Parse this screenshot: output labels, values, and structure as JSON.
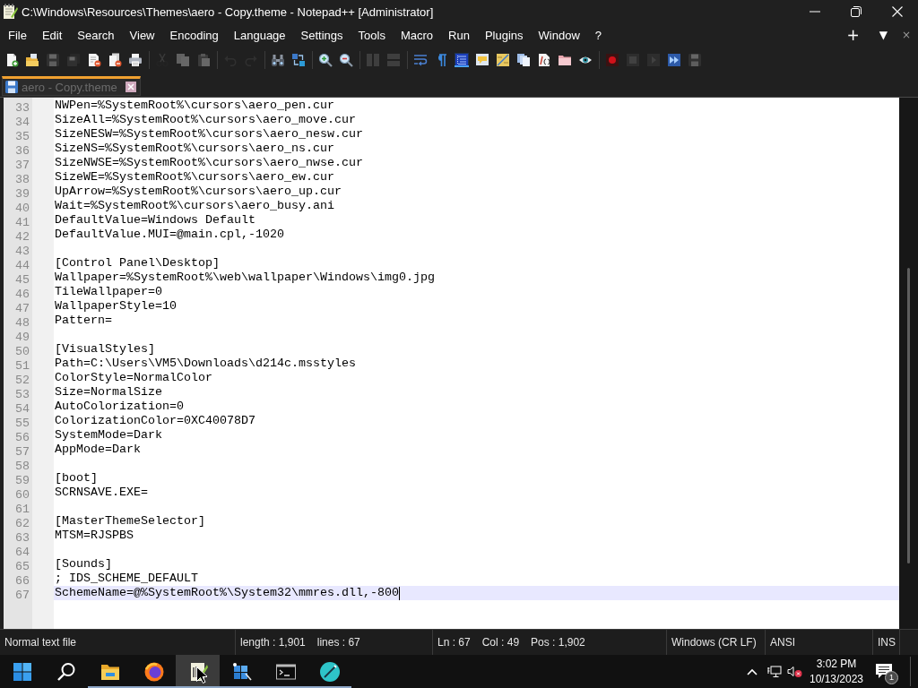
{
  "window": {
    "title": "C:\\Windows\\Resources\\Themes\\aero - Copy.theme - Notepad++ [Administrator]"
  },
  "menu_bar": {
    "items": [
      "File",
      "Edit",
      "Search",
      "View",
      "Encoding",
      "Language",
      "Settings",
      "Tools",
      "Macro",
      "Run",
      "Plugins",
      "Window",
      "?"
    ],
    "right_buttons": [
      {
        "kind": "add",
        "label": "+"
      },
      {
        "kind": "list",
        "label": "▼"
      },
      {
        "kind": "close",
        "label": "×"
      }
    ]
  },
  "toolbar": [
    [
      {
        "kind": "new",
        "disabled": false,
        "on": false
      },
      {
        "kind": "open",
        "disabled": false,
        "on": false
      },
      {
        "kind": "save",
        "disabled": true,
        "on": false
      },
      {
        "kind": "saveall",
        "disabled": true,
        "on": false
      },
      {
        "kind": "close",
        "disabled": false,
        "on": false
      },
      {
        "kind": "closeall",
        "disabled": false,
        "on": false
      },
      {
        "kind": "print",
        "disabled": false,
        "on": false
      }
    ],
    [
      {
        "kind": "cut",
        "disabled": true,
        "on": false
      },
      {
        "kind": "copy",
        "disabled": true,
        "on": false
      },
      {
        "kind": "paste",
        "disabled": true,
        "on": false
      }
    ],
    [
      {
        "kind": "undo",
        "disabled": true,
        "on": false
      },
      {
        "kind": "redo",
        "disabled": true,
        "on": false
      }
    ],
    [
      {
        "kind": "find",
        "disabled": false,
        "on": false
      },
      {
        "kind": "replace",
        "disabled": false,
        "on": false
      }
    ],
    [
      {
        "kind": "zoomin",
        "disabled": false,
        "on": false
      },
      {
        "kind": "zoomout",
        "disabled": false,
        "on": false
      }
    ],
    [
      {
        "kind": "syncv",
        "disabled": true,
        "on": false
      },
      {
        "kind": "synch",
        "disabled": true,
        "on": false
      }
    ],
    [
      {
        "kind": "wrap",
        "disabled": false,
        "on": false
      },
      {
        "kind": "allchars",
        "disabled": false,
        "on": false
      },
      {
        "kind": "indent",
        "disabled": false,
        "on": true
      },
      {
        "kind": "udl",
        "disabled": false,
        "on": false
      },
      {
        "kind": "docmap",
        "disabled": false,
        "on": false
      },
      {
        "kind": "doclist",
        "disabled": false,
        "on": false
      },
      {
        "kind": "funclist",
        "disabled": false,
        "on": false
      },
      {
        "kind": "workspace",
        "disabled": false,
        "on": false
      },
      {
        "kind": "monitor",
        "disabled": false,
        "on": false
      }
    ],
    [
      {
        "kind": "record",
        "disabled": false,
        "on": false
      },
      {
        "kind": "stop",
        "disabled": true,
        "on": false
      },
      {
        "kind": "play",
        "disabled": true,
        "on": false
      },
      {
        "kind": "playmulti",
        "disabled": false,
        "on": false
      },
      {
        "kind": "savemacro",
        "disabled": true,
        "on": false
      }
    ]
  ],
  "tabs": [
    {
      "label": "aero - Copy.theme",
      "selected": true,
      "modified": false
    }
  ],
  "editor": {
    "lines": [
      {
        "number": "33",
        "text": "NWPen=%SystemRoot%\\cursors\\aero_pen.cur",
        "current": false
      },
      {
        "number": "34",
        "text": "SizeAll=%SystemRoot%\\cursors\\aero_move.cur",
        "current": false
      },
      {
        "number": "35",
        "text": "SizeNESW=%SystemRoot%\\cursors\\aero_nesw.cur",
        "current": false
      },
      {
        "number": "36",
        "text": "SizeNS=%SystemRoot%\\cursors\\aero_ns.cur",
        "current": false
      },
      {
        "number": "37",
        "text": "SizeNWSE=%SystemRoot%\\cursors\\aero_nwse.cur",
        "current": false
      },
      {
        "number": "38",
        "text": "SizeWE=%SystemRoot%\\cursors\\aero_ew.cur",
        "current": false
      },
      {
        "number": "39",
        "text": "UpArrow=%SystemRoot%\\cursors\\aero_up.cur",
        "current": false
      },
      {
        "number": "40",
        "text": "Wait=%SystemRoot%\\cursors\\aero_busy.ani",
        "current": false
      },
      {
        "number": "41",
        "text": "DefaultValue=Windows Default",
        "current": false
      },
      {
        "number": "42",
        "text": "DefaultValue.MUI=@main.cpl,-1020",
        "current": false
      },
      {
        "number": "43",
        "current": false
      },
      {
        "number": "44",
        "text": "[Control Panel\\Desktop]",
        "current": false
      },
      {
        "number": "45",
        "text": "Wallpaper=%SystemRoot%\\web\\wallpaper\\Windows\\img0.jpg",
        "current": false
      },
      {
        "number": "46",
        "text": "TileWallpaper=0",
        "current": false
      },
      {
        "number": "47",
        "text": "WallpaperStyle=10",
        "current": false
      },
      {
        "number": "48",
        "text": "Pattern=",
        "current": false
      },
      {
        "number": "49",
        "current": false
      },
      {
        "number": "50",
        "text": "[VisualStyles]",
        "current": false
      },
      {
        "number": "51",
        "text": "Path=C:\\Users\\VM5\\Downloads\\d214c.msstyles",
        "current": false
      },
      {
        "number": "52",
        "text": "ColorStyle=NormalColor",
        "current": false
      },
      {
        "number": "53",
        "text": "Size=NormalSize",
        "current": false
      },
      {
        "number": "54",
        "text": "AutoColorization=0",
        "current": false
      },
      {
        "number": "55",
        "text": "ColorizationColor=0XC40078D7",
        "current": false
      },
      {
        "number": "56",
        "text": "SystemMode=Dark",
        "current": false
      },
      {
        "number": "57",
        "text": "AppMode=Dark",
        "current": false
      },
      {
        "number": "58",
        "current": false
      },
      {
        "number": "59",
        "text": "[boot]",
        "current": false
      },
      {
        "number": "60",
        "text": "SCRNSAVE.EXE=",
        "current": false
      },
      {
        "number": "61",
        "current": false
      },
      {
        "number": "62",
        "text": "[MasterThemeSelector]",
        "current": false
      },
      {
        "number": "63",
        "text": "MTSM=RJSPBS",
        "current": false
      },
      {
        "number": "64",
        "current": false
      },
      {
        "number": "65",
        "text": "[Sounds]",
        "current": false
      },
      {
        "number": "66",
        "text": "; IDS_SCHEME_DEFAULT",
        "current": false
      },
      {
        "number": "67",
        "text": "SchemeName=@%SystemRoot%\\System32\\mmres.dll,-800",
        "current": true
      }
    ]
  },
  "status_bar": {
    "panels": [
      {
        "texts": [
          "Normal text file"
        ]
      },
      {
        "texts": [
          "length : 1,901",
          "lines : 67"
        ]
      },
      {
        "texts": [
          "Ln : 67",
          "Col : 49",
          "Pos : 1,902"
        ]
      },
      {
        "texts": [
          "Windows (CR LF)"
        ]
      },
      {
        "texts": [
          "ANSI"
        ]
      },
      {
        "texts": [
          "INS"
        ]
      }
    ]
  },
  "taskbar": {
    "apps": [
      {
        "kind": "start",
        "running": false,
        "selected": false
      },
      {
        "kind": "search",
        "running": false,
        "selected": false
      },
      {
        "kind": "explorer",
        "running": true,
        "selected": false
      },
      {
        "kind": "browser",
        "running": true,
        "selected": false
      },
      {
        "kind": "notepad",
        "running": true,
        "selected": true
      },
      {
        "kind": "tiles",
        "running": true,
        "selected": false
      },
      {
        "kind": "terminal",
        "running": true,
        "selected": false
      },
      {
        "kind": "pen",
        "running": true,
        "selected": false
      }
    ],
    "clock": {
      "time": "3:02 PM",
      "date": "10/13/2023"
    },
    "notification_count": "1"
  }
}
